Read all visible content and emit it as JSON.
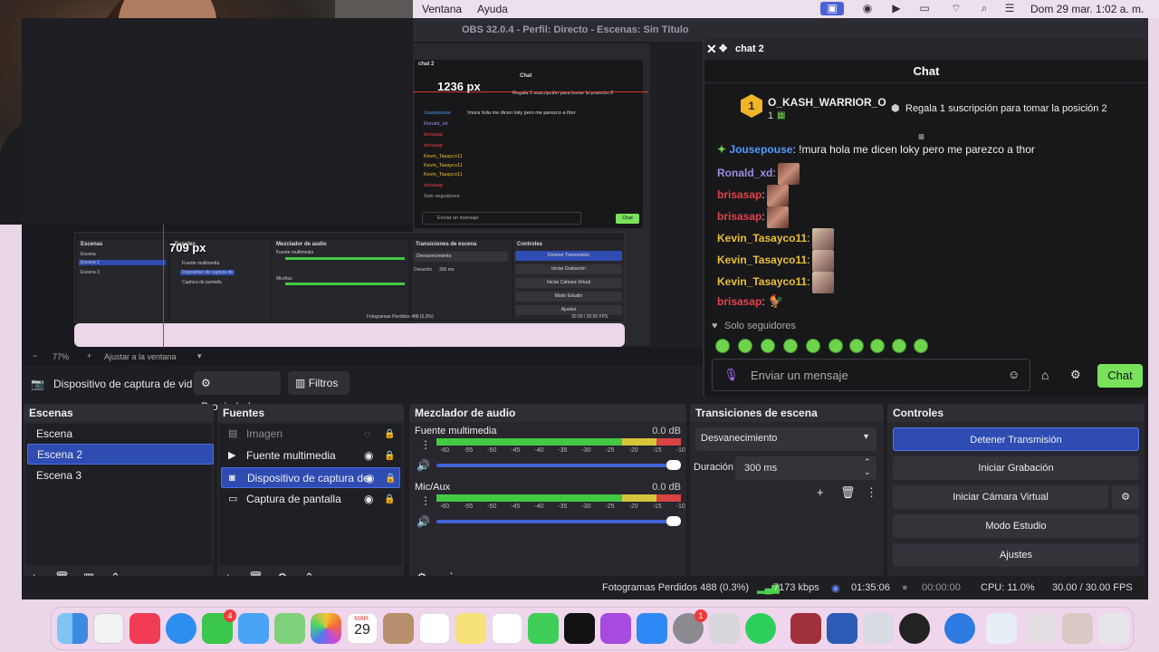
{
  "menubar": {
    "items": [
      "Ventana",
      "Ayuda"
    ],
    "datetime": "Dom 29 mar.  1:02 a. m."
  },
  "window_title": "OBS 32.0.4 - Perfil: Directo - Escenas: Sin Título",
  "preview": {
    "measure_h": "1236 px",
    "measure_v": "709 px",
    "zoom": "77%",
    "fit_label": "Ajustar a la ventana"
  },
  "source_toolbar": {
    "selected_source": "Dispositivo de captura de vid",
    "properties": "Propiedades",
    "filters": "Filtros"
  },
  "scenes": {
    "title": "Escenas",
    "items": [
      {
        "label": "Escena",
        "selected": false
      },
      {
        "label": "Escena 2",
        "selected": true
      },
      {
        "label": "Escena 3",
        "selected": false
      }
    ]
  },
  "sources": {
    "title": "Fuentes",
    "items": [
      {
        "label": "Imagen"
      },
      {
        "label": "Fuente multimedia"
      },
      {
        "label": "Dispositivo de captura de"
      },
      {
        "label": "Captura de pantalla"
      }
    ]
  },
  "mixer": {
    "title": "Mezclador de audio",
    "channels": [
      {
        "name": "Fuente multimedia",
        "db": "0.0 dB",
        "level": 1.0
      },
      {
        "name": "Mic/Aux",
        "db": "0.0 dB",
        "level": 1.0
      }
    ],
    "scale": "-60 -55 -50 -45 -40 -35 -30 -25 -20 -15 -10 -5 0"
  },
  "transitions": {
    "title": "Transiciones de escena",
    "type": "Desvanecimiento",
    "duration_label": "Duración",
    "duration": "300 ms"
  },
  "controls": {
    "title": "Controles",
    "buttons": [
      "Detener Transmisión",
      "Iniciar Grabación",
      "Iniciar Cámara Virtual",
      "Modo Estudio",
      "Ajustes"
    ]
  },
  "status": {
    "dropped": "Fotogramas Perdidos 488 (0.3%)",
    "bitrate": "7173 kbps",
    "stream_time": "01:35:06",
    "rec_time": "00:00:00",
    "cpu": "CPU: 11.0%",
    "fps": "30.00 / 30.00 FPS"
  },
  "chat": {
    "dock_title": "chat 2",
    "header": "Chat",
    "top_user": "O_KASH_WARRIOR_O",
    "top_rank": "1",
    "top_count": "1",
    "gift_text": "Regala 1 suscripción para tomar la posición 2",
    "messages": [
      {
        "user": "Jousepouse",
        "text": "!mura hola me dicen loky pero me parezco a thor",
        "color": "#4f9cff"
      },
      {
        "user": "Ronald_xd",
        "text": "",
        "color": "#9b8fe0"
      },
      {
        "user": "brisasap",
        "text": "",
        "color": "#e0434b"
      },
      {
        "user": "brisasap",
        "text": "",
        "color": "#e0434b"
      },
      {
        "user": "Kevin_Tasayco11",
        "text": "",
        "color": "#e8c033"
      },
      {
        "user": "Kevin_Tasayco11",
        "text": "",
        "color": "#e8c033"
      },
      {
        "user": "Kevin_Tasayco11",
        "text": "",
        "color": "#e8c033"
      },
      {
        "user": "brisasap",
        "text": "",
        "color": "#e0434b"
      }
    ],
    "followers_only": "Solo seguidores",
    "input_placeholder": "Enviar un mensaje",
    "send_label": "Chat"
  },
  "dock": {
    "calendar_month": "MAR.",
    "calendar_day": "29",
    "badge_messages": "4",
    "badge_settings": "1"
  }
}
